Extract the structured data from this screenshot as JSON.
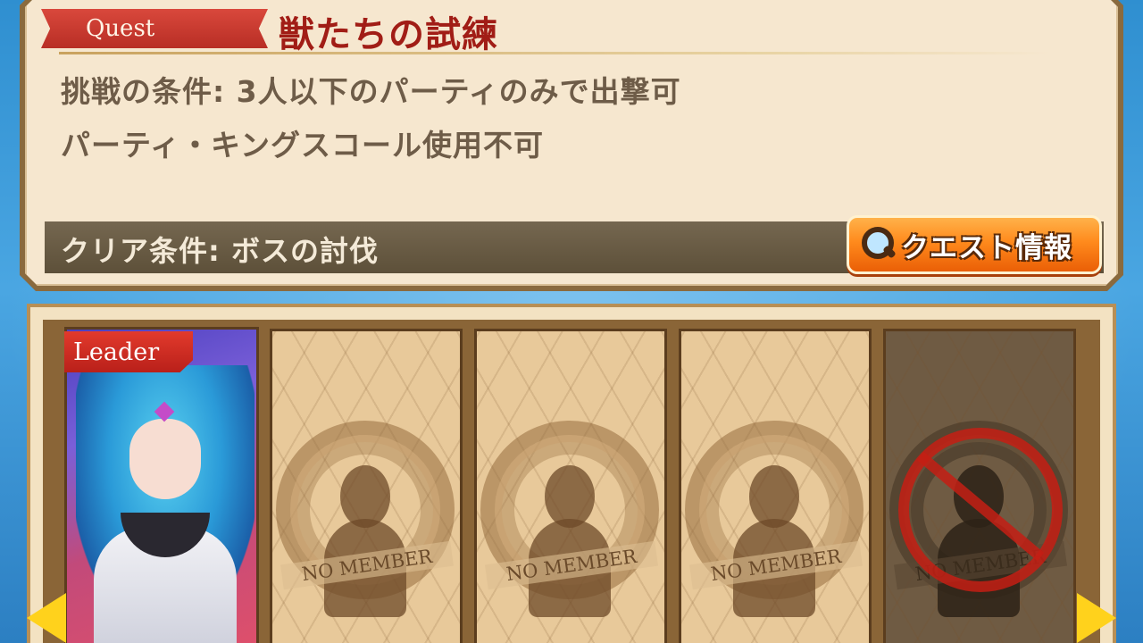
{
  "quest": {
    "tag": "Quest",
    "title": "獣たちの試練",
    "condition_1": "挑戦の条件: 3人以下のパーティのみで出撃可",
    "condition_2": "パーティ・キングスコール使用不可",
    "clear_condition": "クリア条件: ボスの討伐",
    "info_button": "クエスト情報"
  },
  "party": {
    "leader_label": "Leader",
    "slots": [
      {
        "label": "NO MEMBER",
        "state": "empty"
      },
      {
        "label": "NO MEMBER",
        "state": "empty"
      },
      {
        "label": "NO MEMBER",
        "state": "empty"
      },
      {
        "label": "NO MEMBER",
        "state": "unavailable"
      }
    ]
  },
  "colors": {
    "title_red": "#a11d16",
    "accent_orange": "#ff8a1c",
    "arrow_yellow": "#ffd21c"
  },
  "icons": {
    "info_button_icon": "magnifier-icon",
    "nav_left": "arrow-left-icon",
    "nav_right": "arrow-right-icon",
    "disabled_slot": "prohibited-icon"
  }
}
